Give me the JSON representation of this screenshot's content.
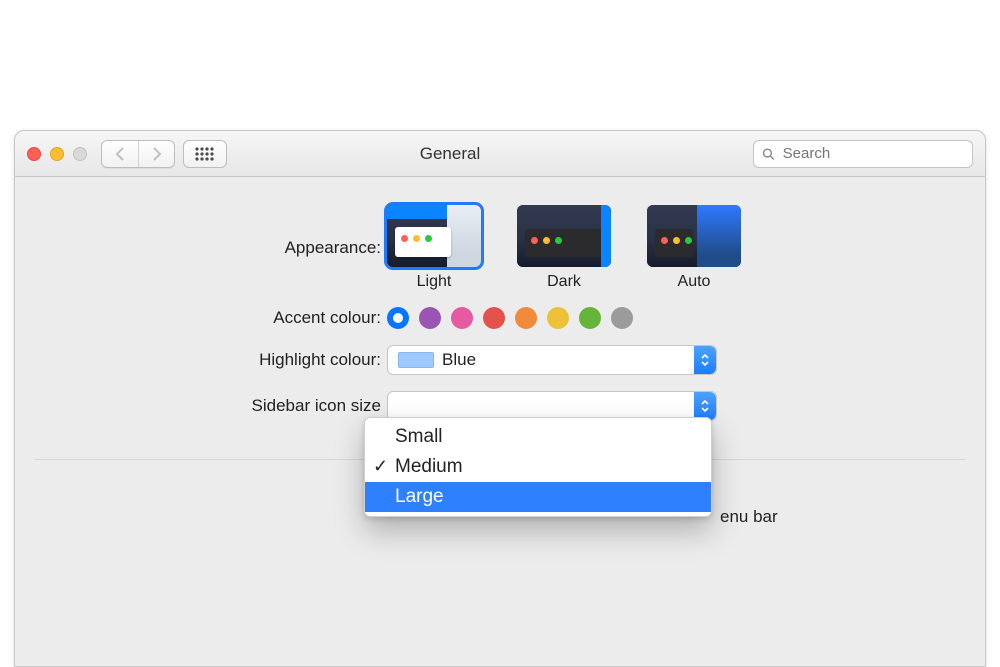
{
  "window": {
    "title": "General"
  },
  "toolbar": {
    "search_placeholder": "Search"
  },
  "appearance": {
    "label": "Appearance:",
    "options": {
      "light": "Light",
      "dark": "Dark",
      "auto": "Auto"
    },
    "selected": "Light"
  },
  "accent": {
    "label": "Accent colour:",
    "colors": {
      "blue": "#0776ff",
      "purple": "#9a54b4",
      "pink": "#e55aa0",
      "red": "#e4524c",
      "orange": "#ef8b3a",
      "yellow": "#eec238",
      "green": "#65b53a",
      "grey": "#9b9b9b"
    },
    "selected": "blue"
  },
  "highlight": {
    "label": "Highlight colour:",
    "selected": "Blue"
  },
  "sidebar_icon_size": {
    "label": "Sidebar icon size",
    "options": [
      "Small",
      "Medium",
      "Large"
    ],
    "checked": "Medium",
    "highlighted": "Large"
  },
  "menubar_fragment": "enu bar"
}
